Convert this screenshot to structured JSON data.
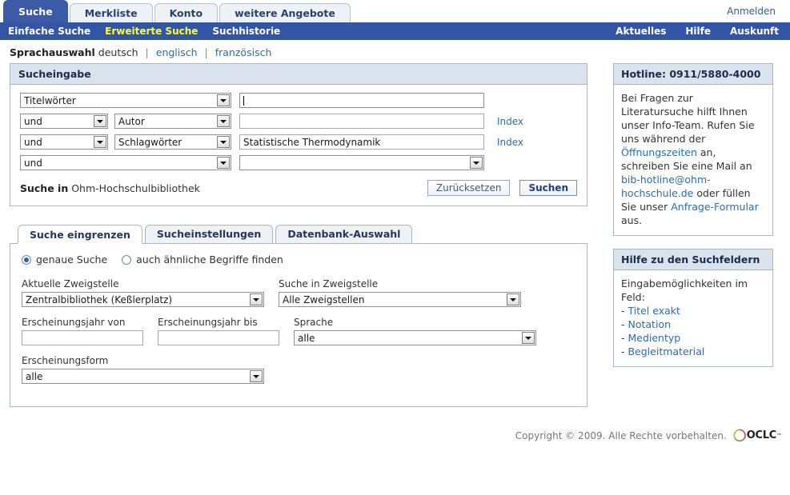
{
  "header": {
    "tabs": [
      {
        "label": "Suche",
        "active": true
      },
      {
        "label": "Merkliste",
        "active": false
      },
      {
        "label": "Konto",
        "active": false
      },
      {
        "label": "weitere Angebote",
        "active": false
      }
    ],
    "login_label": "Anmelden"
  },
  "nav": {
    "left_items": [
      {
        "label": "Einfache Suche",
        "current": false
      },
      {
        "label": "Erweiterte Suche",
        "current": true
      },
      {
        "label": "Suchhistorie",
        "current": false
      }
    ],
    "right_items": [
      {
        "label": "Aktuelles"
      },
      {
        "label": "Hilfe"
      },
      {
        "label": "Auskunft"
      }
    ]
  },
  "language": {
    "label": "Sprachauswahl",
    "current": "deutsch",
    "options": [
      "englisch",
      "französisch"
    ],
    "separator": "|"
  },
  "search_panel": {
    "title": "Sucheingabe",
    "rows": [
      {
        "operator": null,
        "field": "Titelwörter",
        "value": "",
        "value_type": "text",
        "focused": true,
        "index_link": null
      },
      {
        "operator": "und",
        "field": "Autor",
        "value": "",
        "value_type": "text",
        "focused": false,
        "index_link": "Index"
      },
      {
        "operator": "und",
        "field": "Schlagwörter",
        "value": "Statistische Thermodynamik",
        "value_type": "text",
        "focused": false,
        "index_link": "Index"
      },
      {
        "operator": "und",
        "field": "",
        "value": "",
        "value_type": "select",
        "focused": false,
        "index_link": null
      }
    ],
    "scope_label": "Suche in",
    "scope_value": "Ohm-Hochschulbibliothek",
    "reset_label": "Zurücksetzen",
    "submit_label": "Suchen"
  },
  "subtabs": [
    {
      "label": "Suche eingrenzen",
      "active": true
    },
    {
      "label": "Sucheinstellungen",
      "active": false
    },
    {
      "label": "Datenbank-Auswahl",
      "active": false
    }
  ],
  "refine": {
    "match_options": [
      {
        "label": "genaue Suche",
        "checked": true
      },
      {
        "label": "auch ähnliche Begriffe finden",
        "checked": false
      }
    ],
    "fields": [
      {
        "label": "Aktuelle Zweigstelle",
        "value": "Zentralbibliothek (Keßlerplatz)",
        "type": "select"
      },
      {
        "label": "Suche in Zweigstelle",
        "value": "Alle Zweigstellen",
        "type": "select"
      },
      {
        "label": "Erscheinungsjahr von",
        "value": "",
        "type": "text"
      },
      {
        "label": "Erscheinungsjahr  bis",
        "value": "",
        "type": "text"
      },
      {
        "label": "Sprache",
        "value": "alle",
        "type": "select"
      },
      {
        "label": "Erscheinungsform",
        "value": "alle",
        "type": "select"
      }
    ]
  },
  "sidebar": {
    "hotline": {
      "title": "Hotline: 0911/5880-4000",
      "text_1": "Bei Fragen zur Literatursuche hilft Ihnen unser Info-Team. Rufen Sie uns während der ",
      "link_1": "Öffnungszeiten",
      "text_2": " an, schreiben Sie eine Mail an ",
      "link_2": "bib-hotline@ohm-hochschule.de",
      "text_3": " oder füllen Sie unser ",
      "link_3": "Anfrage-Formular",
      "text_4": " aus."
    },
    "help": {
      "title": "Hilfe zu den Suchfeldern",
      "intro": "Eingabemöglichkeiten im Feld:",
      "items": [
        "Titel exakt",
        "Notation",
        "Medientyp",
        "Begleitmaterial"
      ],
      "bullet": "- "
    }
  },
  "footer": {
    "copyright": "Copyright © 2009. Alle Rechte vorbehalten.",
    "logo_text": "OCLC",
    "logo_tm": "™"
  },
  "colors": {
    "nav_blue": "#3355a5",
    "active_tab_blue": "#3c5aa6",
    "current_nav_yellow": "#ffff33",
    "panel_head": "#dae2ee",
    "link_blue": "#2b6cb0",
    "border": "#a9b6ca"
  }
}
